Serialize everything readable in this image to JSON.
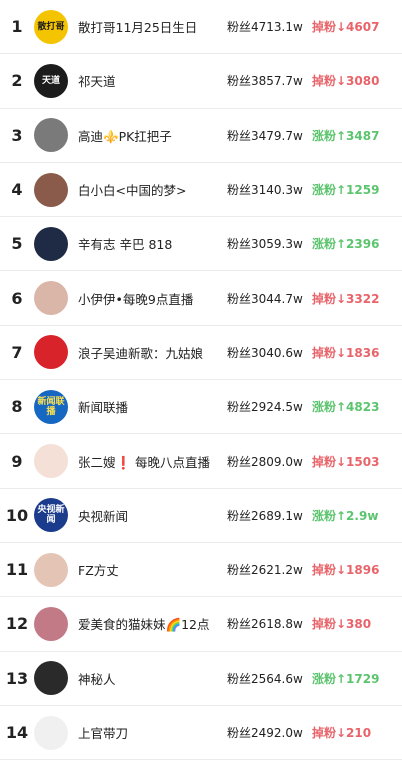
{
  "colors": {
    "down": "#e8646a",
    "up": "#5cc46e"
  },
  "rows": [
    {
      "rank": "1",
      "name": "散打哥11月25日生日",
      "fans": "粉丝4713.1w",
      "change": "掉粉↓4607",
      "dir": "down",
      "avatar_icon": "sandage-logo-icon",
      "avatar_text": "散打哥",
      "avatar_bg": "#f5c400",
      "avatar_fg": "#1a1a1a"
    },
    {
      "rank": "2",
      "name": "祁天道",
      "fans": "粉丝3857.7w",
      "change": "掉粉↓3080",
      "dir": "down",
      "avatar_icon": "calligraphy-avatar-icon",
      "avatar_text": "天道",
      "avatar_bg": "#1c1c1c",
      "avatar_fg": "#ffffff"
    },
    {
      "rank": "3",
      "name": "高迪⚜️PK扛把子",
      "fans": "粉丝3479.7w",
      "change": "涨粉↑3487",
      "dir": "up",
      "avatar_icon": "person-photo-icon",
      "avatar_text": "",
      "avatar_bg": "#7a7a7a",
      "avatar_fg": "#ffffff"
    },
    {
      "rank": "4",
      "name": "白小白<中国的梦>",
      "fans": "粉丝3140.3w",
      "change": "涨粉↑1259",
      "dir": "up",
      "avatar_icon": "person-photo-icon",
      "avatar_text": "",
      "avatar_bg": "#8a5a4a",
      "avatar_fg": "#ffffff"
    },
    {
      "rank": "5",
      "name": "辛有志 辛巴 818",
      "fans": "粉丝3059.3w",
      "change": "涨粉↑2396",
      "dir": "up",
      "avatar_icon": "person-photo-icon",
      "avatar_text": "",
      "avatar_bg": "#1f2a44",
      "avatar_fg": "#ffffff"
    },
    {
      "rank": "6",
      "name": "小伊伊•每晚9点直播",
      "fans": "粉丝3044.7w",
      "change": "掉粉↓3322",
      "dir": "down",
      "avatar_icon": "person-photo-icon",
      "avatar_text": "",
      "avatar_bg": "#d9b6a8",
      "avatar_fg": "#ffffff"
    },
    {
      "rank": "7",
      "name": "浪子吴迪新歌：九姑娘",
      "fans": "粉丝3040.6w",
      "change": "掉粉↓1836",
      "dir": "down",
      "avatar_icon": "person-photo-icon",
      "avatar_text": "",
      "avatar_bg": "#d8232a",
      "avatar_fg": "#ffffff"
    },
    {
      "rank": "8",
      "name": "新闻联播",
      "fans": "粉丝2924.5w",
      "change": "涨粉↑4823",
      "dir": "up",
      "avatar_icon": "news-logo-icon",
      "avatar_text": "新闻联播",
      "avatar_bg": "#1667c2",
      "avatar_fg": "#ffe14d"
    },
    {
      "rank": "9",
      "name": "张二嫂❗️ 每晚八点直播",
      "fans": "粉丝2809.0w",
      "change": "掉粉↓1503",
      "dir": "down",
      "avatar_icon": "cartoon-avatar-icon",
      "avatar_text": "",
      "avatar_bg": "#f4e0d6",
      "avatar_fg": "#333333"
    },
    {
      "rank": "10",
      "name": "央视新闻",
      "fans": "粉丝2689.1w",
      "change": "涨粉↑2.9w",
      "dir": "up",
      "avatar_icon": "cctv-news-logo-icon",
      "avatar_text": "央视新闻",
      "avatar_bg": "#1b3c8c",
      "avatar_fg": "#ffffff"
    },
    {
      "rank": "11",
      "name": "FZ方丈",
      "fans": "粉丝2621.2w",
      "change": "掉粉↓1896",
      "dir": "down",
      "avatar_icon": "person-photo-icon",
      "avatar_text": "",
      "avatar_bg": "#e4c4b4",
      "avatar_fg": "#ffffff"
    },
    {
      "rank": "12",
      "name": "爱美食的猫妹妹🌈12点",
      "fans": "粉丝2618.8w",
      "change": "掉粉↓380",
      "dir": "down",
      "avatar_icon": "person-photo-icon",
      "avatar_text": "",
      "avatar_bg": "#c27a86",
      "avatar_fg": "#ffffff"
    },
    {
      "rank": "13",
      "name": "神秘人",
      "fans": "粉丝2564.6w",
      "change": "涨粉↑1729",
      "dir": "up",
      "avatar_icon": "person-photo-icon",
      "avatar_text": "",
      "avatar_bg": "#2a2a2a",
      "avatar_fg": "#ffffff"
    },
    {
      "rank": "14",
      "name": "上官带刀",
      "fans": "粉丝2492.0w",
      "change": "掉粉↓210",
      "dir": "down",
      "avatar_icon": "cartoon-avatar-icon",
      "avatar_text": "",
      "avatar_bg": "#f0f0f0",
      "avatar_fg": "#111111"
    }
  ]
}
